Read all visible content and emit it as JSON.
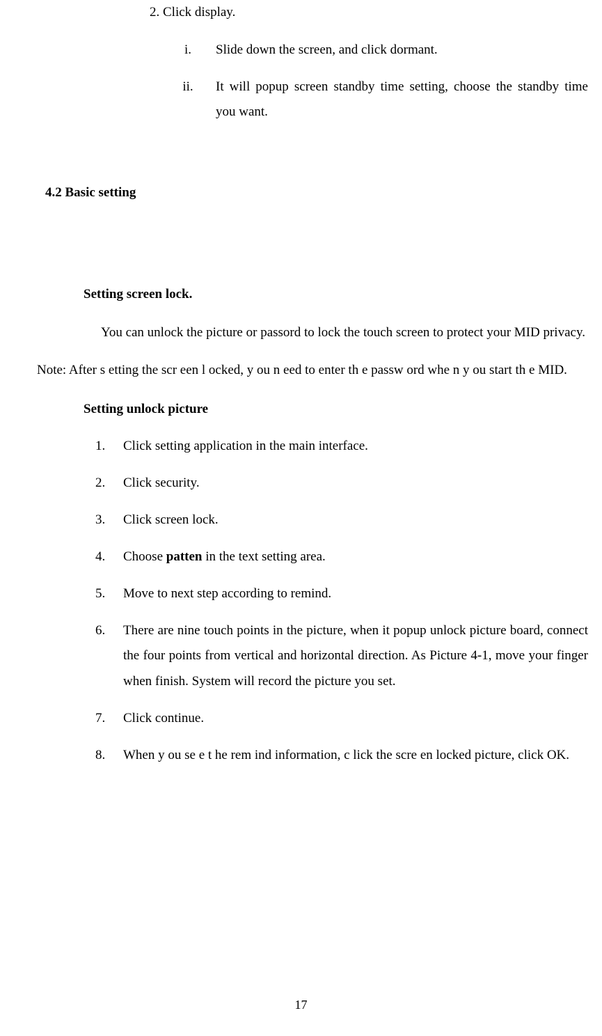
{
  "step2": "2. Click display.",
  "roman": {
    "i": {
      "marker": "i.",
      "text": "Slide down the screen, and click dormant."
    },
    "ii": {
      "marker": "ii.",
      "text": "It will popup screen standby time setting, choose the standby time you want."
    }
  },
  "section_heading": "4.2 Basic setting",
  "screenlock": {
    "heading": "Setting screen lock.",
    "intro": "You can unlock the picture or passord to lock the touch screen to protect your MID privacy.",
    "note": "Note: After s etting the scr een l ocked, y ou n eed to  enter th e passw ord whe n y ou start th e MID."
  },
  "unlock": {
    "heading": "Setting unlock picture",
    "items": {
      "1": {
        "marker": "1.",
        "text": "Click setting application in the main interface."
      },
      "2": {
        "marker": "2.",
        "text": "Click security."
      },
      "3": {
        "marker": "3.",
        "text": "Click screen lock."
      },
      "4": {
        "marker": "4.",
        "prefix": "Choose ",
        "bold": "patten",
        "suffix": " in the text setting area."
      },
      "5": {
        "marker": "5.",
        "text": "Move to next step according to remind."
      },
      "6": {
        "marker": "6.",
        "text": "There are nine touch points in the picture, when it popup unlock picture board, connect the four points from vertical and horizontal direction. As Picture 4-1, move your finger when finish. System will record the picture you set."
      },
      "7": {
        "marker": "7.",
        "text": "Click continue."
      },
      "8": {
        "marker": "8.",
        "text": "When y ou se e t he rem ind information, c lick the scre en locked picture, click OK."
      }
    }
  },
  "page_number": "17"
}
